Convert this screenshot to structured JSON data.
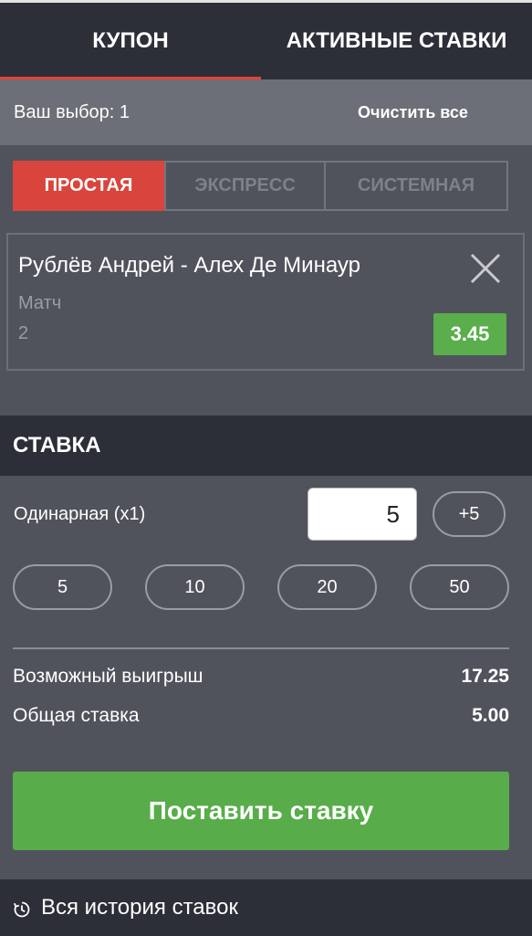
{
  "tabs": {
    "coupon": "КУПОН",
    "active_bets": "АКТИВНЫЕ СТАВКИ"
  },
  "selection": {
    "label": "Ваш выбор: 1",
    "clear": "Очистить все"
  },
  "bet_types": {
    "simple": "ПРОСТАЯ",
    "express": "ЭКСПРЕСС",
    "system": "СИСТЕМНАЯ"
  },
  "event": {
    "title": "Рублёв Андрей - Алех Де Минаур",
    "market": "Матч",
    "outcome": "2",
    "odds": "3.45"
  },
  "stake": {
    "title": "СТАВКА",
    "single_label": "Одинарная (x1)",
    "input_value": "5",
    "plus_button": "+5",
    "quick_amounts": [
      "5",
      "10",
      "20",
      "50"
    ],
    "potential_win_label": "Возможный выигрыш",
    "potential_win_value": "17.25",
    "total_stake_label": "Общая ставка",
    "total_stake_value": "5.00",
    "place_button": "Поставить ставку"
  },
  "history": {
    "label": "Вся история ставок",
    "icon": "clock-icon"
  },
  "colors": {
    "accent_red": "#d9453c",
    "odds_green": "#5aae4c",
    "panel": "#50535c",
    "header_dark": "#2c2e38"
  }
}
